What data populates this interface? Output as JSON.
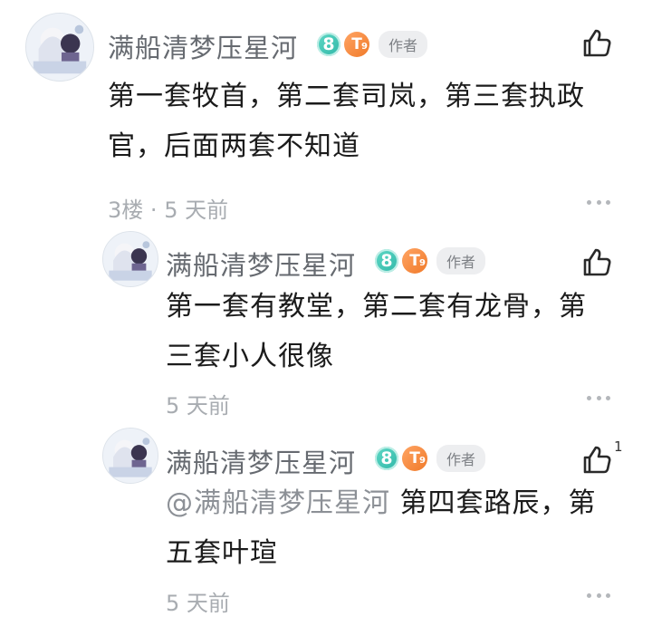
{
  "comments": [
    {
      "name": "满船清梦压星河",
      "level": "8",
      "badge": "T",
      "badge_sub": "9",
      "author_tag": "作者",
      "text_lines": [
        "第一套牧首，第二套司岚，第三套执政",
        "官，后面两套不知道"
      ],
      "floor": "3楼",
      "sep": "·",
      "time": "5 天前",
      "likes": ""
    },
    {
      "name": "满船清梦压星河",
      "level": "8",
      "badge": "T",
      "badge_sub": "9",
      "author_tag": "作者",
      "text_lines": [
        "第一套有教堂，第二套有龙骨，第",
        "三套小人很像"
      ],
      "time": "5 天前",
      "likes": ""
    },
    {
      "name": "满船清梦压星河",
      "level": "8",
      "badge": "T",
      "badge_sub": "9",
      "author_tag": "作者",
      "mention": "@满船清梦压星河",
      "text_line1_rest": "第四套路辰，第",
      "text_line2": "五套叶瑄",
      "time": "5 天前",
      "likes": "1"
    }
  ],
  "colors": {
    "name": "#666a70",
    "text": "#1b1b1b",
    "meta": "#a8acb1",
    "level": "#31b7a8",
    "badge": "#f07a2a"
  },
  "icons": {
    "like": "thumbs-up-icon",
    "more": "more-dots-icon",
    "avatar": "anime-avatar"
  }
}
